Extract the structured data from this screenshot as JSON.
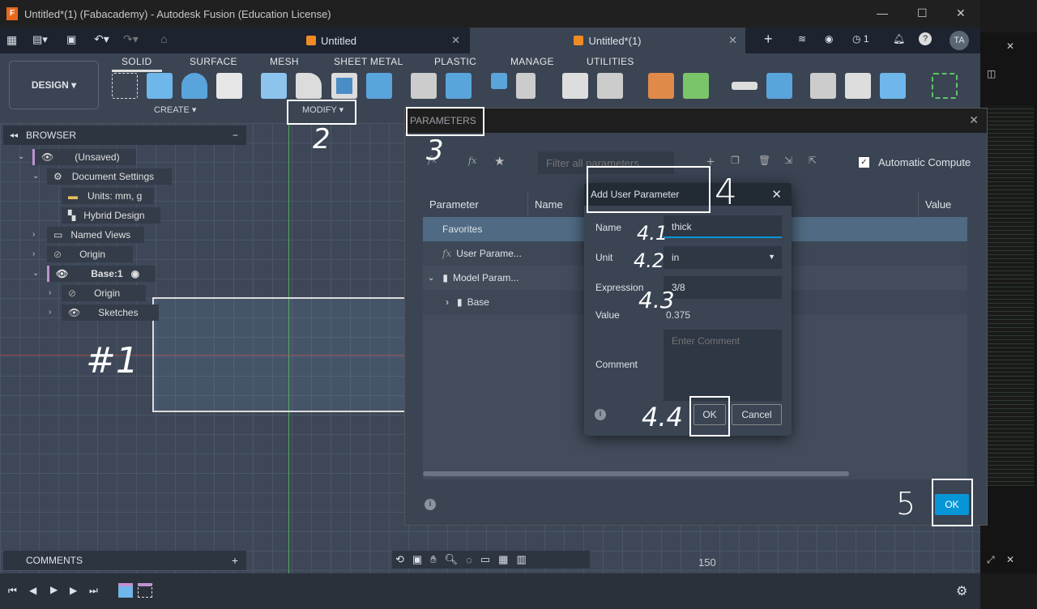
{
  "window": {
    "title": "Untitled*(1) (Fabacademy) - Autodesk Fusion (Education License)",
    "minimize": "—",
    "maximize": "☐",
    "close": "✕"
  },
  "tabs": [
    {
      "label": "Untitled",
      "close": "✕"
    },
    {
      "label": "Untitled*(1)",
      "close": "✕"
    }
  ],
  "tabbar": {
    "new_tab": "+",
    "jobs": "1",
    "avatar": "TA"
  },
  "ribbon": {
    "workspace": "DESIGN ▾",
    "tabs": [
      "SOLID",
      "SURFACE",
      "MESH",
      "SHEET METAL",
      "PLASTIC",
      "MANAGE",
      "UTILITIES"
    ],
    "groups": {
      "create": "CREATE ▾",
      "modify": "MODIFY ▾"
    }
  },
  "browser": {
    "title": "BROWSER",
    "collapse": "−",
    "items": [
      {
        "label": "(Unsaved)"
      },
      {
        "label": "Document Settings"
      },
      {
        "label": "Units: mm, g"
      },
      {
        "label": "Hybrid Design"
      },
      {
        "label": "Named Views"
      },
      {
        "label": "Origin"
      },
      {
        "label": "Base:1"
      },
      {
        "label": "Origin"
      },
      {
        "label": "Sketches"
      }
    ]
  },
  "comments": {
    "title": "COMMENTS",
    "add": "+"
  },
  "canvas": {
    "ruler_label": "150"
  },
  "parameters": {
    "title": "PARAMETERS",
    "filter_placeholder": "Filter all parameters",
    "auto_compute": "Automatic Compute",
    "auto_compute_checked": true,
    "columns": [
      "Parameter",
      "Name",
      "Value"
    ],
    "rows": [
      {
        "label": "Favorites"
      },
      {
        "label": "User Parame..."
      },
      {
        "label": "Model Param..."
      },
      {
        "label": "Base"
      }
    ],
    "ok": "OK"
  },
  "add_user_parameter": {
    "title": "Add User Parameter",
    "name_label": "Name",
    "name_value": "thick",
    "unit_label": "Unit",
    "unit_value": "in",
    "expression_label": "Expression",
    "expression_value": "3/8",
    "value_label": "Value",
    "value": "0.375",
    "comment_label": "Comment",
    "comment_placeholder": "Enter Comment",
    "ok": "OK",
    "cancel": "Cancel"
  },
  "annotations": {
    "a1": "#1",
    "a2": "2",
    "a3": "3",
    "a4": "4",
    "a41": "4.1",
    "a42": "4.2",
    "a43": "4.3",
    "a44": "4.4",
    "a5": "5"
  },
  "colors": {
    "accent": "#0696d7",
    "ok_button": "#0696d7",
    "favorites_row": "#4f6a82"
  }
}
